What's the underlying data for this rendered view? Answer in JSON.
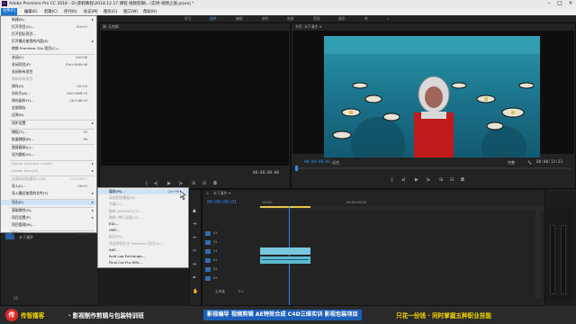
{
  "window": {
    "icon": "Pr",
    "title": "Adobe Premiere Pro CC 2018 - D:\\赤鹤教程\\2018.12.17 课程 视频剪辑\\...\\实例-视频之旅.prproj *"
  },
  "menubar": [
    "文件(F)",
    "编辑(E)",
    "剪辑(C)",
    "序列(S)",
    "标记(M)",
    "图形(G)",
    "窗口(W)",
    "帮助(H)"
  ],
  "workspaces": [
    "学习",
    "组件",
    "编辑",
    "颜色",
    "效果",
    "音频",
    "图形",
    "库",
    "»"
  ],
  "file_menu": [
    {
      "label": "新建(N)",
      "shortcut": "",
      "arrow": true
    },
    {
      "label": "打开项目(O)...",
      "shortcut": "Ctrl+O"
    },
    {
      "label": "打开团队项目...",
      "shortcut": ""
    },
    {
      "label": "打开最近使用的内容(E)",
      "shortcut": "",
      "arrow": true
    },
    {
      "label": "转换 Premiere Clip 项目(C)...",
      "shortcut": ""
    },
    {
      "label": "关闭(C)",
      "shortcut": "Ctrl+W",
      "sep": true
    },
    {
      "label": "关闭项目(P)",
      "shortcut": "Ctrl+Shift+W"
    },
    {
      "label": "关闭所有项目",
      "shortcut": ""
    },
    {
      "label": "刷新所有项目",
      "shortcut": "",
      "disabled": true
    },
    {
      "label": "保存(S)",
      "shortcut": "Ctrl+S"
    },
    {
      "label": "另存为(A)...",
      "shortcut": "Ctrl+Shift+S"
    },
    {
      "label": "保存副本(Y)...",
      "shortcut": "Ctrl+Alt+S"
    },
    {
      "label": "全部保存",
      "shortcut": ""
    },
    {
      "label": "还原(R)",
      "shortcut": ""
    },
    {
      "label": "同步设置",
      "shortcut": "",
      "arrow": true,
      "sep": true
    },
    {
      "label": "捕捉(T)...",
      "shortcut": "F5",
      "sep": true
    },
    {
      "label": "批量捕捉(B)...",
      "shortcut": "F6"
    },
    {
      "label": "链接媒体(L)...",
      "shortcut": "",
      "sep": true
    },
    {
      "label": "设为脱机(O)...",
      "shortcut": ""
    },
    {
      "label": "Adobe Dynamic Link(K)",
      "shortcut": "",
      "arrow": true,
      "disabled": true,
      "sep": true
    },
    {
      "label": "Adobe Story(R)",
      "shortcut": "",
      "arrow": true,
      "disabled": true
    },
    {
      "label": "从媒体浏览器导入(M)",
      "shortcut": "Ctrl+Alt+I",
      "disabled": true,
      "sep": true
    },
    {
      "label": "导入(I)...",
      "shortcut": "Ctrl+I"
    },
    {
      "label": "导入最近使用的文件(F)",
      "shortcut": "",
      "arrow": true
    },
    {
      "label": "导出(E)",
      "shortcut": "",
      "arrow": true,
      "highlighted": true,
      "sep": true
    },
    {
      "label": "获取属性(G)",
      "shortcut": "",
      "arrow": true,
      "sep": true
    },
    {
      "label": "项目设置(P)",
      "shortcut": "",
      "arrow": true
    },
    {
      "label": "项目管理(M)...",
      "shortcut": ""
    },
    {
      "label": "退出(X)",
      "shortcut": "Ctrl+Q",
      "sep": true
    }
  ],
  "export_menu": [
    {
      "label": "媒体(M)...",
      "shortcut": "Ctrl+M",
      "highlighted": true
    },
    {
      "label": "动态图形模板(R)...",
      "shortcut": "",
      "disabled": true
    },
    {
      "label": "字幕(C)...",
      "shortcut": "",
      "disabled": true
    },
    {
      "label": "磁带 (DV/HDV)(T)...",
      "shortcut": "",
      "disabled": true
    },
    {
      "label": "磁带 (串行设备)(S)...",
      "shortcut": "",
      "disabled": true
    },
    {
      "label": "EDL...",
      "shortcut": ""
    },
    {
      "label": "OMF...",
      "shortcut": ""
    },
    {
      "label": "标记(M)...",
      "shortcut": "",
      "disabled": true
    },
    {
      "label": "将选择项作为 Premiere 项目(S)...",
      "shortcut": "",
      "disabled": true
    },
    {
      "label": "AAF...",
      "shortcut": ""
    },
    {
      "label": "Avid Log Exchange...",
      "shortcut": ""
    },
    {
      "label": "Final Cut Pro XML...",
      "shortcut": ""
    }
  ],
  "source_panel": {
    "tab": "源: 无剪辑",
    "timecode": "00:00:00:00"
  },
  "program_panel": {
    "tab": "节目: 水下漫步 ≡",
    "timecode_left": "00:00:00:01",
    "fit_label": "适合",
    "quality_label": "完整",
    "timecode_right": "00:00:13:23"
  },
  "timeline_panel": {
    "close_label": "×",
    "tab": "水下漫步 ≡",
    "timecode": "00:00:00:01",
    "ruler_start": ":00:00",
    "ruler_mid": "00:00:05:00",
    "tracks": [
      "V3",
      "V2",
      "V1",
      "A1",
      "A2",
      "A3",
      "主声道"
    ],
    "master_value": "0.0"
  },
  "project_panel": {
    "item": "水下漫步",
    "count_label": "15"
  },
  "banner": {
    "logo": "传",
    "brand": "传智播客",
    "slogan": "· 影视制作剪辑与包装特训班",
    "course": "影视编导  视频剪辑  AE特效合成  C4D三维实训  影视包装项目",
    "right": "只花一份钱 · 同时掌握五种职业技能"
  },
  "colors": {
    "accent": "#2d8cf0",
    "menu_highlight": "#cfe3f7",
    "brand_yellow": "#f5d800"
  }
}
